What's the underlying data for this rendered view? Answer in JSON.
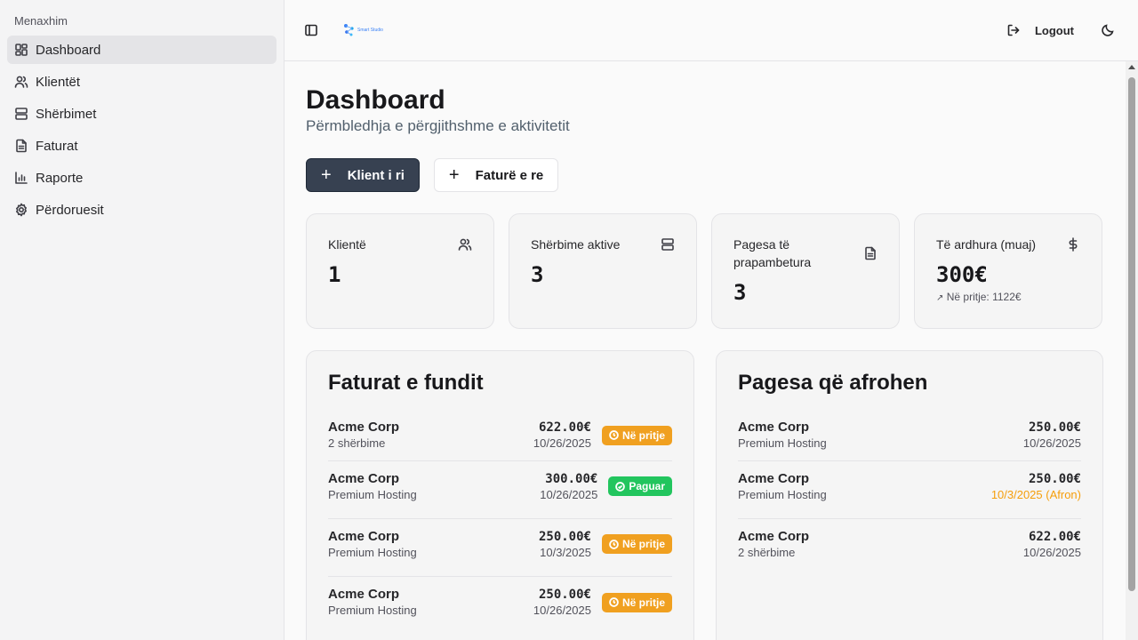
{
  "sidebar": {
    "group_label": "Menaxhim",
    "items": [
      {
        "label": "Dashboard",
        "icon": "dashboard-icon"
      },
      {
        "label": "Klientët",
        "icon": "users-icon"
      },
      {
        "label": "Shërbimet",
        "icon": "server-icon"
      },
      {
        "label": "Faturat",
        "icon": "file-icon"
      },
      {
        "label": "Raporte",
        "icon": "bar-chart-icon"
      },
      {
        "label": "Përdoruesit",
        "icon": "gear-icon"
      }
    ]
  },
  "header": {
    "logout_label": "Logout",
    "logo_text": "Smart Studio"
  },
  "page": {
    "title": "Dashboard",
    "subtitle": "Përmbledhja e përgjithshme e aktivitetit"
  },
  "actions": {
    "new_client": "Klient i ri",
    "new_invoice": "Faturë e re"
  },
  "stats": [
    {
      "label": "Klientë",
      "value": "1",
      "sub": ""
    },
    {
      "label": "Shërbime aktive",
      "value": "3",
      "sub": ""
    },
    {
      "label": "Pagesa të prapambetura",
      "value": "3",
      "sub": ""
    },
    {
      "label": "Të ardhura (muaj)",
      "value": "300€",
      "sub": "Në pritje: 1122€"
    }
  ],
  "recent_invoices": {
    "title": "Faturat e fundit",
    "rows": [
      {
        "name": "Acme Corp",
        "desc": "2 shërbime",
        "amount": "622.00€",
        "date": "10/26/2025",
        "status": "Në pritje"
      },
      {
        "name": "Acme Corp",
        "desc": "Premium Hosting",
        "amount": "300.00€",
        "date": "10/26/2025",
        "status": "Paguar"
      },
      {
        "name": "Acme Corp",
        "desc": "Premium Hosting",
        "amount": "250.00€",
        "date": "10/3/2025",
        "status": "Në pritje"
      },
      {
        "name": "Acme Corp",
        "desc": "Premium Hosting",
        "amount": "250.00€",
        "date": "10/26/2025",
        "status": "Në pritje"
      }
    ]
  },
  "upcoming_payments": {
    "title": "Pagesa që afrohen",
    "rows": [
      {
        "name": "Acme Corp",
        "desc": "Premium Hosting",
        "amount": "250.00€",
        "date": "10/26/2025"
      },
      {
        "name": "Acme Corp",
        "desc": "Premium Hosting",
        "amount": "250.00€",
        "date": "10/3/2025 (Afron)"
      },
      {
        "name": "Acme Corp",
        "desc": "2 shërbime",
        "amount": "622.00€",
        "date": "10/26/2025"
      }
    ]
  },
  "colors": {
    "pending": "#f0a020",
    "paid": "#22c55e",
    "primary": "#374151",
    "warn": "#f59e0b"
  }
}
